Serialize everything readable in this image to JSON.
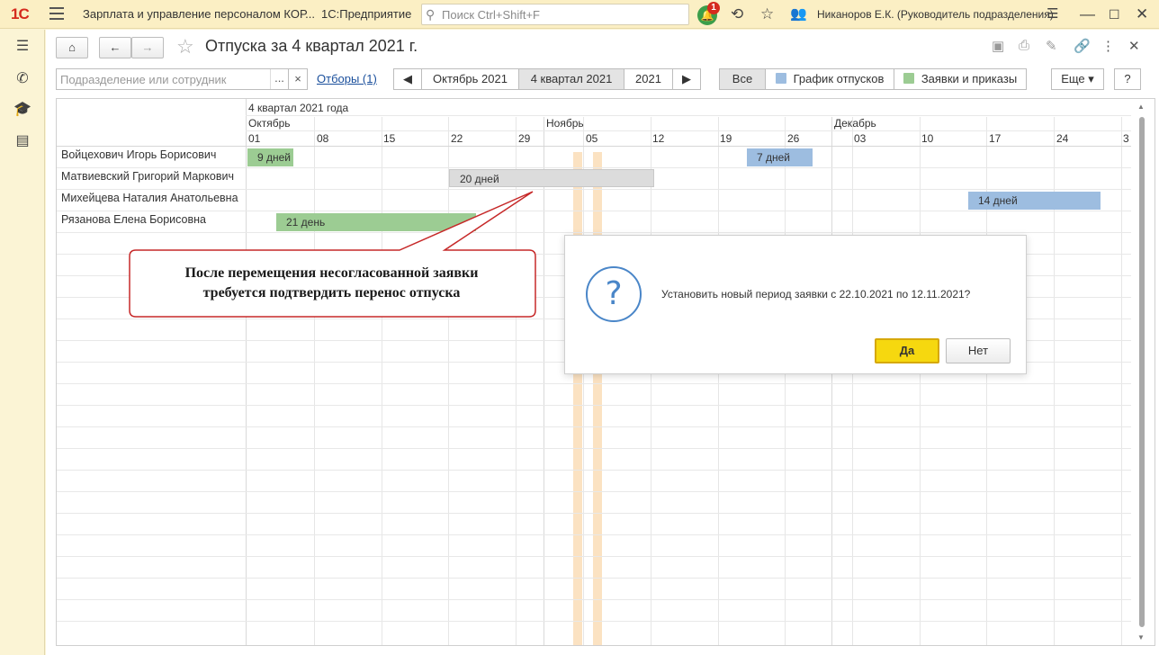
{
  "app": {
    "logo": "1С",
    "title": "Зарплата и управление персоналом КОР...",
    "platform": "1С:Предприятие",
    "search_placeholder": "Поиск Ctrl+Shift+F",
    "notifications_count": "1",
    "user": "Никаноров Е.К. (Руководитель подразделения)"
  },
  "page": {
    "title": "Отпуска за 4 квартал 2021 г."
  },
  "toolbar": {
    "filter_placeholder": "Подразделение или сотрудник",
    "dots": "...",
    "clear": "×",
    "filters_link": "Отборы (1)",
    "period_tabs": [
      "Октябрь 2021",
      "4 квартал 2021",
      "2021"
    ],
    "active_period": "4 квартал 2021",
    "type_tabs": [
      "Все",
      "График отпусков",
      "Заявки и приказы"
    ],
    "more": "Еще",
    "help": "?"
  },
  "gantt": {
    "period_title": "4 квартал 2021 года",
    "months": [
      "Октябрь",
      "Ноябрь",
      "Декабрь"
    ],
    "days": [
      "01",
      "08",
      "15",
      "22",
      "29",
      "05",
      "12",
      "19",
      "26",
      "03",
      "10",
      "17",
      "24",
      "3"
    ],
    "employees": [
      "Войцехович Игорь Борисович",
      "Матвиевский Григорий Маркович",
      "Михейцева Наталия Анатольевна",
      "Рязанова Елена Борисовна"
    ],
    "bars": [
      {
        "label": "9 дней",
        "color": "green"
      },
      {
        "label": "7 дней",
        "color": "blue"
      },
      {
        "label": "20 дней",
        "color": "gray"
      },
      {
        "label": "14 дней",
        "color": "blue"
      },
      {
        "label": "21 день",
        "color": "green"
      }
    ]
  },
  "dialog": {
    "message": "Установить новый период заявки с 22.10.2021 по 12.11.2021?",
    "yes": "Да",
    "no": "Нет"
  },
  "callout": {
    "line1": "После перемещения несогласованной заявки",
    "line2": "требуется подтвердить перенос отпуска"
  },
  "colors": {
    "green_bar": "#9ccc93",
    "blue_bar": "#9dbde0",
    "gray_bar": "#dcdcdc",
    "holiday": "#fbe2c2",
    "callout_border": "#c62828",
    "primary_button": "#f6d80f"
  }
}
